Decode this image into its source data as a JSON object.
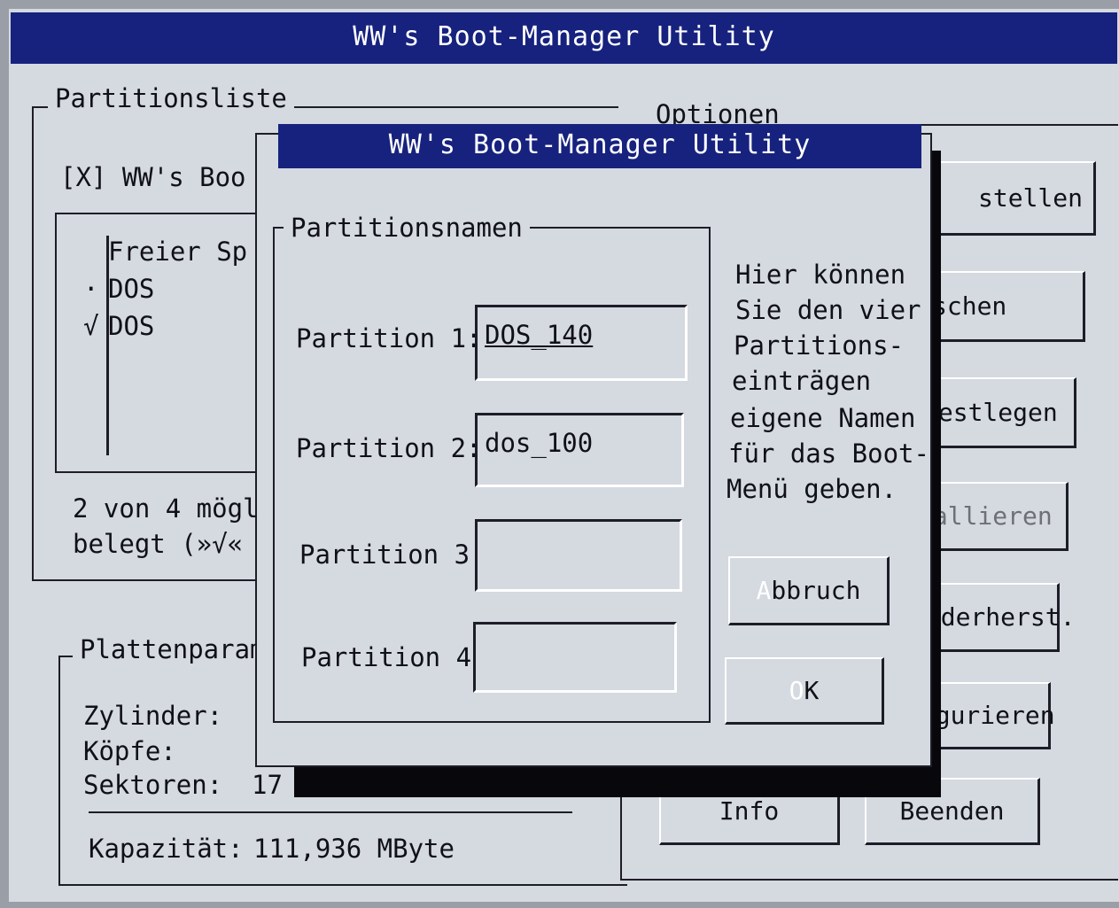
{
  "main_window": {
    "title": "WW's Boot-Manager Utility",
    "partition_list": {
      "label": "Partitionsliste",
      "boot_entry": "[X] WW's Boo",
      "rows": [
        {
          "mark": "",
          "name": "Freier Sp"
        },
        {
          "mark": "·",
          "name": "DOS"
        },
        {
          "mark": "√",
          "name": "DOS"
        }
      ],
      "status_line1": "2 von 4 mögl",
      "status_line2": "belegt (»√«"
    },
    "disk_params": {
      "label": "Plattenparam",
      "cylinders_label": "Zylinder:",
      "heads_label": "Köpfe:",
      "sectors_label": "Sektoren:",
      "sectors_value": "17",
      "capacity_label": "Kapazität:",
      "capacity_value": "111,936 MByte"
    },
    "options": {
      "label": "Optionen",
      "buttons": [
        "stellen",
        "schen",
        "festlegen",
        "tallieren",
        "iederherst.",
        "figurieren"
      ]
    },
    "info_button": "Info",
    "quit_button": "Beenden"
  },
  "dialog": {
    "title": "WW's Boot-Manager Utility",
    "group_label": "Partitionsnamen",
    "fields": [
      {
        "label": "Partition 1:",
        "value": "DOS_140"
      },
      {
        "label": "Partition 2:",
        "value": "dos_100"
      },
      {
        "label": "Partition 3:",
        "value": ""
      },
      {
        "label": "Partition 4:",
        "value": ""
      }
    ],
    "help_lines": [
      "Hier können",
      "Sie den vier",
      "Partitions-",
      "einträgen",
      "eigene Namen",
      "für das Boot-",
      "Menü geben."
    ],
    "cancel_hotkey": "A",
    "cancel_rest": "bbruch",
    "ok_hotkey": "O",
    "ok_rest": "K"
  }
}
